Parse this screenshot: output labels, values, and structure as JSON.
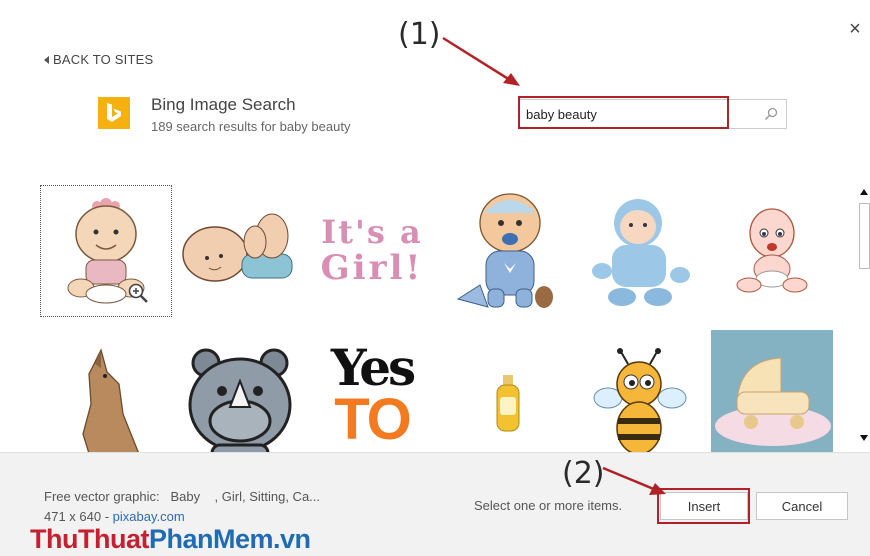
{
  "header": {
    "back_label": "BACK TO SITES",
    "provider_title": "Bing Image Search",
    "result_count": "189 search results for baby beauty",
    "close_glyph": "×"
  },
  "search": {
    "value": "baby beauty",
    "placeholder": ""
  },
  "annotations": {
    "step1": "(1)",
    "step2": "(2)",
    "color": "#b22125"
  },
  "results": [
    {
      "name": "baby-girl-sitting",
      "selected": true
    },
    {
      "name": "baby-lying"
    },
    {
      "name": "its-a-girl"
    },
    {
      "name": "baby-with-pacifier"
    },
    {
      "name": "doll-in-blue"
    },
    {
      "name": "crying-baby"
    },
    {
      "name": "kangaroo"
    },
    {
      "name": "rhino"
    },
    {
      "name": "yes-to"
    },
    {
      "name": "baby-lotion"
    },
    {
      "name": "bee"
    },
    {
      "name": "baby-carriage-cake"
    }
  ],
  "its_a_girl_text": {
    "line1": "It's a",
    "line2": "Girl!"
  },
  "yes_to_text": {
    "line1": "Yes",
    "line2": "TO"
  },
  "footer": {
    "info_label": "Free vector graphic:",
    "info_tags": "Baby    , Girl, Sitting, Ca...",
    "dimensions": "471 x 640 - ",
    "source": "pixabay.com",
    "status": "Select one or more items.",
    "insert_label": "Insert",
    "cancel_label": "Cancel"
  },
  "watermark": {
    "part1": "ThuThuat",
    "part2": "PhanMem.vn"
  },
  "colors": {
    "bing": "#f5b10f",
    "link": "#2b6cb0",
    "watermark_red": "#c4202f",
    "watermark_blue": "#1f6bb4"
  }
}
